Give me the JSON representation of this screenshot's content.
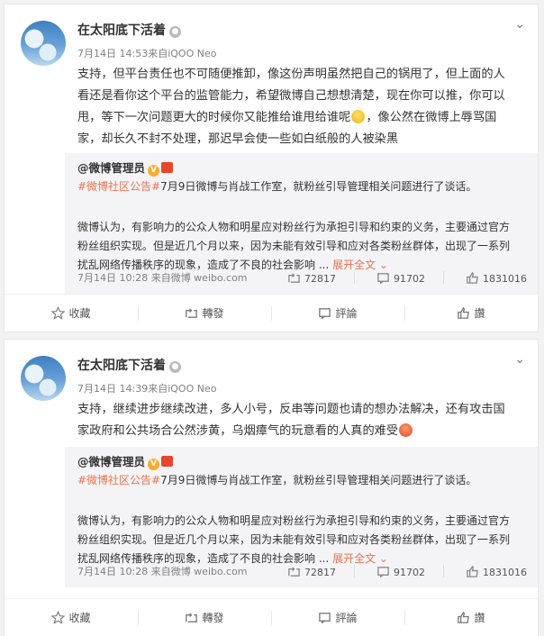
{
  "posts": [
    {
      "username": "在太阳底下活着",
      "time_source": "7月14日 14:53来自iQOO Neo",
      "text_part1": "支持，但平台责任也不可随便推卸，像这份声明虽然把自己的锅甩了，但上面的人看还是看你这个平台的监管能力，希望微博自己想想清楚，现在你可以推，你可以甩，等下一次问题更大的时候你又能推给谁甩给谁呢",
      "text_part2": "，像公然在微博上辱骂国家，却长久不封不处理，那迟早会使一些如白纸般的人被染黑",
      "emoji": "smile",
      "repost": {
        "user": "@微博管理员",
        "tag": "#微博社区公告#",
        "headline": "7月9日微博与肖战工作室，就粉丝引导管理相关问题进行了谈话。",
        "body": "微博认为，有影响力的公众人物和明星应对粉丝行为承担引导和约束的义务，主要通过官方粉丝组织实现。但是近几个月以来，因为未能有效引导和应对各类粉丝群体，出现了一系列扰乱网络传播秩序的现象，造成了不良的社会影响 ...",
        "more": "展开全文",
        "meta": "7月14日 10:28 来自微博 weibo.com",
        "reposts": "72817",
        "comments": "91702",
        "likes": "1831016"
      }
    },
    {
      "username": "在太阳底下活着",
      "time_source": "7月14日 14:39来自iQOO Neo",
      "text_part1": "支持，继续进步继续改进，多人小号，反串等问题也请的想办法解决，还有攻击国家政府和公共场合公然涉黄，乌烟瘴气的玩意看的人真的难受",
      "text_part2": "",
      "emoji": "angry",
      "repost": {
        "user": "@微博管理员",
        "tag": "#微博社区公告#",
        "headline": "7月9日微博与肖战工作室，就粉丝引导管理相关问题进行了谈话。",
        "body": "微博认为，有影响力的公众人物和明星应对粉丝行为承担引导和约束的义务，主要通过官方粉丝组织实现。但是近几个月以来，因为未能有效引导和应对各类粉丝群体，出现了一系列扰乱网络传播秩序的现象，造成了不良的社会影响 ...",
        "more": "展开全文",
        "meta": "7月14日 10:28 来自微博 weibo.com",
        "reposts": "72817",
        "comments": "91702",
        "likes": "1831016"
      }
    }
  ],
  "actions": {
    "favorite": "收藏",
    "repost": "轉發",
    "comment": "評論",
    "like": "讚"
  }
}
